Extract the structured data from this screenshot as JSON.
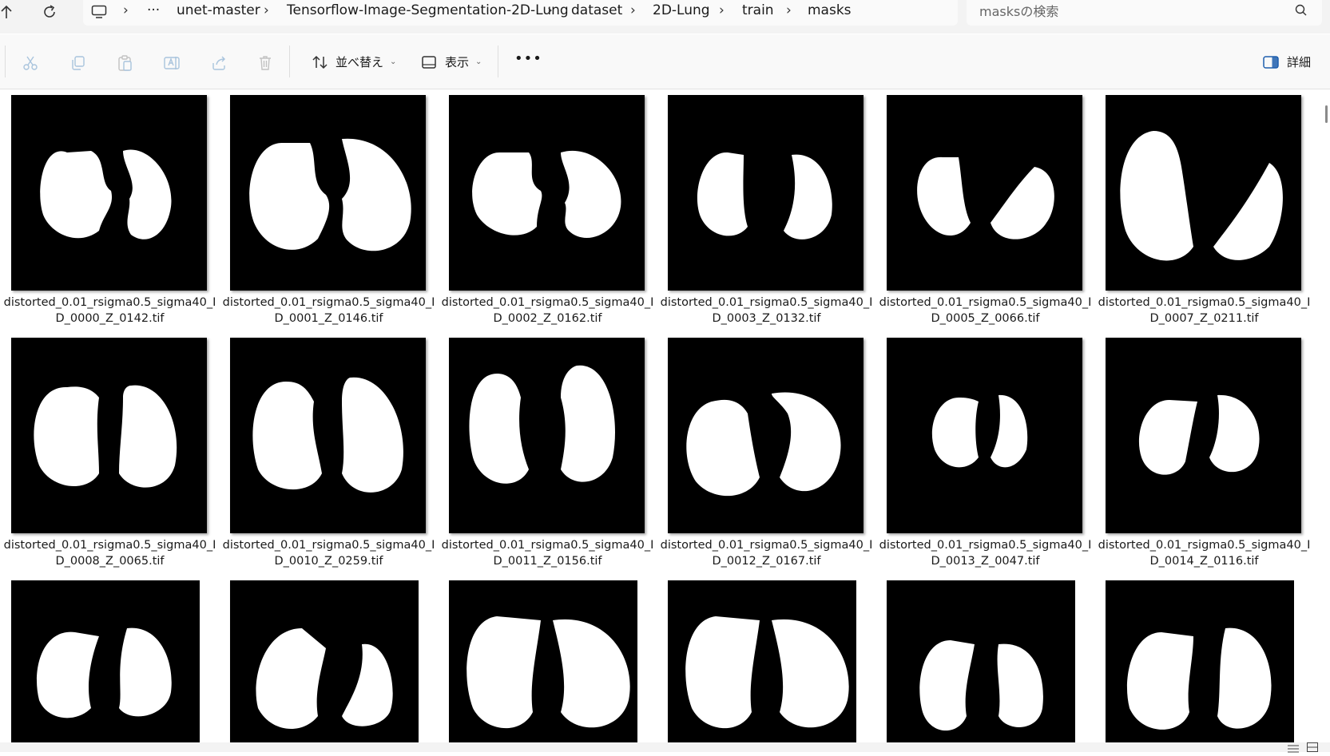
{
  "address_bar": {
    "crumbs": [
      "unet-master",
      "Tensorflow-Image-Segmentation-2D-Lung",
      "dataset",
      "2D-Lung",
      "train",
      "masks"
    ],
    "overflow": "···",
    "search_placeholder": "masksの検索"
  },
  "toolbar": {
    "sort_label": "並べ替え",
    "view_label": "表示",
    "more_label": "•••",
    "details_label": "詳細"
  },
  "files": [
    "distorted_0.01_rsigma0.5_sigma40_ID_0000_Z_0142.tif",
    "distorted_0.01_rsigma0.5_sigma40_ID_0001_Z_0146.tif",
    "distorted_0.01_rsigma0.5_sigma40_ID_0002_Z_0162.tif",
    "distorted_0.01_rsigma0.5_sigma40_ID_0003_Z_0132.tif",
    "distorted_0.01_rsigma0.5_sigma40_ID_0005_Z_0066.tif",
    "distorted_0.01_rsigma0.5_sigma40_ID_0007_Z_0211.tif",
    "distorted_0.01_rsigma0.5_sigma40_ID_0008_Z_0065.tif",
    "distorted_0.01_rsigma0.5_sigma40_ID_0010_Z_0259.tif",
    "distorted_0.01_rsigma0.5_sigma40_ID_0011_Z_0156.tif",
    "distorted_0.01_rsigma0.5_sigma40_ID_0012_Z_0167.tif",
    "distorted_0.01_rsigma0.5_sigma40_ID_0013_Z_0047.tif",
    "distorted_0.01_rsigma0.5_sigma40_ID_0014_Z_0116.tif",
    "",
    "",
    "",
    "",
    "",
    ""
  ]
}
